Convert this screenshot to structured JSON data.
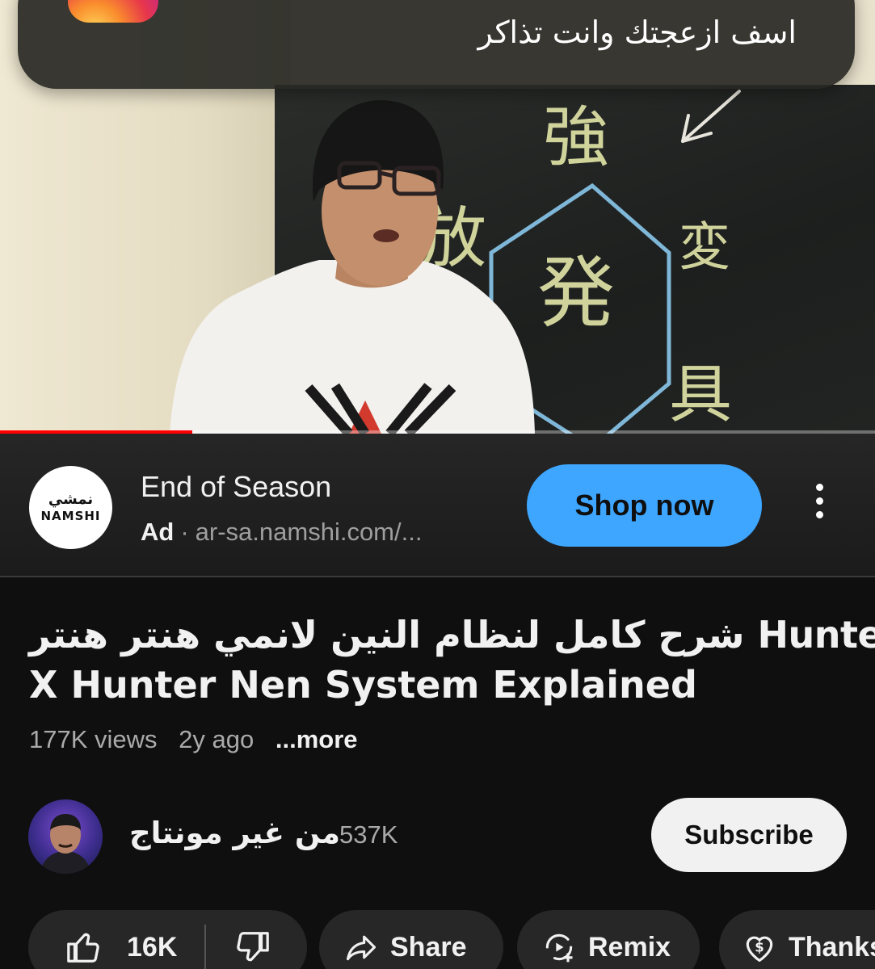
{
  "notification": {
    "app": "Instagram",
    "icon": "instagram-icon",
    "message": "اسف ازعجتك وانت تذاكر"
  },
  "video": {
    "progress": 0.22,
    "board_characters": [
      "強",
      "放",
      "変",
      "発",
      "具"
    ],
    "colors": {
      "progress": "#ff0000",
      "board_text": "#dfe3a6",
      "hexagon": "#7fb7d8"
    }
  },
  "ad": {
    "logo_text_arabic": "نمشي",
    "logo_text": "NAMSHI",
    "title": "End of Season",
    "label": "Ad",
    "separator": "·",
    "url": "ar-sa.namshi.com/...",
    "cta": "Shop now",
    "cta_color": "#3ea6ff",
    "menu_icon": "more-vert-icon"
  },
  "video_info": {
    "title_line1": "شرح كامل لنظام النين لانمي هنتر هنتر Hunter",
    "title_line2": "X Hunter Nen System Explained",
    "views": "177K views",
    "age": "2y ago",
    "more": "...more"
  },
  "channel": {
    "name": "من غير مونتاج",
    "subscribers": "537K",
    "subscribe_label": "Subscribe"
  },
  "actions": {
    "likes": "16K",
    "like_icon": "thumb-up-icon",
    "dislike_icon": "thumb-down-icon",
    "share": "Share",
    "share_icon": "share-icon",
    "remix": "Remix",
    "remix_icon": "remix-icon",
    "thanks": "Thanks",
    "thanks_icon": "thanks-icon"
  }
}
